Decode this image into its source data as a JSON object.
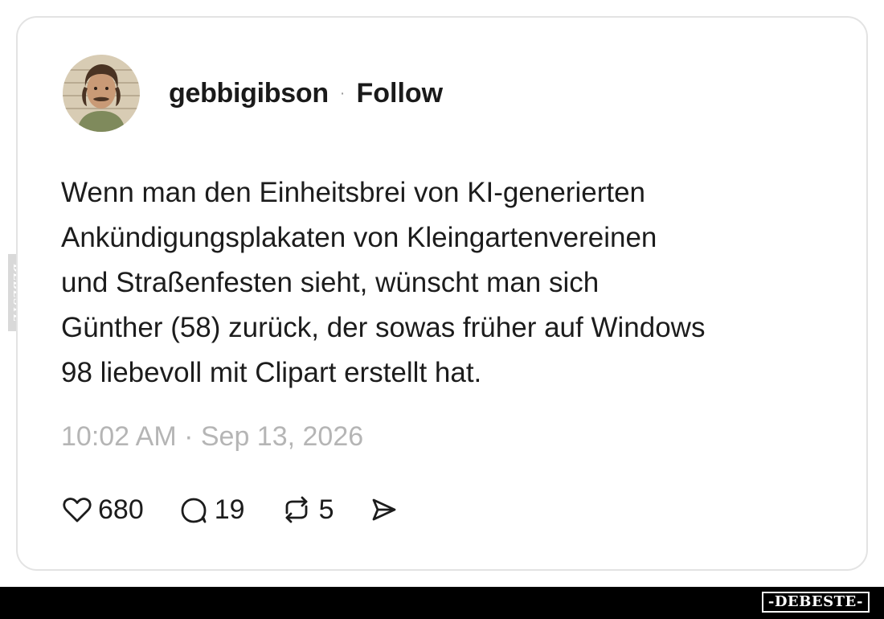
{
  "post": {
    "username": "gebbigibson",
    "separator": "·",
    "follow_label": "Follow",
    "text_lines": [
      "Wenn man den Einheitsbrei von KI-generierten",
      "Ankündigungsplakaten von Kleingartenvereinen",
      "und Straßenfesten sieht, wünscht man sich",
      "Günther (58) zurück, der sowas früher auf Windows",
      "98 liebevoll mit Clipart erstellt hat."
    ],
    "timestamp": "10:02 AM · Sep 13, 2026"
  },
  "actions": {
    "like": {
      "icon": "heart-icon",
      "count": "680"
    },
    "reply": {
      "icon": "comment-icon",
      "count": "19"
    },
    "repost": {
      "icon": "repost-icon",
      "count": "5"
    },
    "share": {
      "icon": "send-icon"
    }
  },
  "watermark": {
    "logo_text": "-DEBESTE-",
    "side_text": "DEBESTE"
  },
  "colors": {
    "text": "#1a1a1a",
    "muted": "#b5b5b5",
    "border": "#e3e3e3",
    "bar": "#000000"
  }
}
